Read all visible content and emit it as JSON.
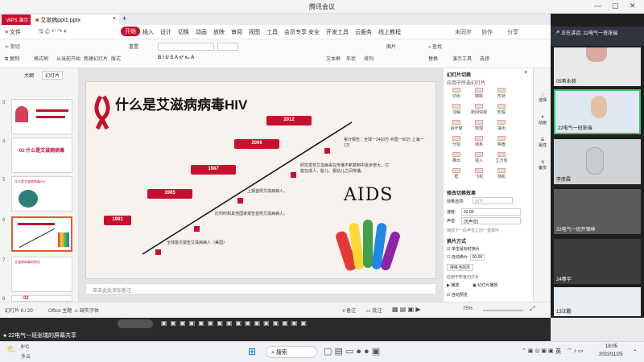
{
  "window_title": "腾讯会议",
  "app": {
    "tabs": [
      "WPS 演示",
      "艾滋病ppt1.pptx"
    ],
    "menu": [
      "≡ 文件",
      "开始",
      "插入",
      "设计",
      "切换",
      "动画",
      "放映",
      "审阅",
      "视图",
      "工具",
      "会员专享",
      "安全",
      "开发工具",
      "云服务",
      "线上教程"
    ],
    "menu_right": [
      "未同步",
      "协作",
      "分享"
    ],
    "ribbon_labels": [
      "剪切",
      "复制",
      "格式刷",
      "从当前开始",
      "新建幻灯片",
      "版式",
      "重置",
      "文本框",
      "形状",
      "排列",
      "图片",
      "查找",
      "替换",
      "演示工具",
      "选择"
    ],
    "pane_tabs": [
      "大纲",
      "幻灯片"
    ],
    "slide_numbers": [
      "3",
      "4",
      "5",
      "6",
      "7",
      "8"
    ],
    "thumb_titles": [
      "01 什么是艾滋病病毒",
      "什么是艾滋病病毒HIV",
      "艾滋病病毒的特点",
      "02"
    ],
    "notes_placeholder": "单击此处添加备注",
    "status": {
      "slide_count": "幻灯片 6 / 20",
      "theme": "Office 主题",
      "font_missing": "缺失字体",
      "notes_btn": "备注",
      "comments_btn": "批注",
      "zoom": "75%"
    }
  },
  "slide": {
    "title": "什么是艾滋病病毒HIV",
    "years": [
      "1981",
      "1985",
      "1987",
      "2006",
      "2012"
    ],
    "events": [
      "全球首次报告艾滋病病人（美国）",
      "比利时和其他国家报告首例艾滋病病人。",
      "上报首例艾滋病病人。",
      "研究发现艾滋病毒在传播不断复制中逐步增大，它能在成人、胎儿、婴幼儿之间传播。",
      "累计报告：全球一2400万 中国一50万 上海一1万"
    ],
    "aids_logo": "AIDS"
  },
  "transition_pane": {
    "header": "幻灯片切换",
    "apply_label": "应用于所选幻灯片",
    "effects": [
      "切出",
      "擦除",
      "形状",
      "溶解",
      "新闻快报",
      "轮辐",
      "百叶窗",
      "梳理",
      "抽出",
      "分割",
      "线条",
      "棋盘",
      "推出",
      "插入",
      "立方体",
      "框",
      "飞机",
      "随机"
    ],
    "modify_header": "修改切换效果",
    "effect_label": "效果选项:",
    "effect_value": "向下",
    "speed_label": "速度:",
    "speed_value": "02.00",
    "sound_label": "声音:",
    "sound_value": "[无声音]",
    "sound_loop": "播放下一段声音之前一直循环",
    "advance_header": "换片方式",
    "click_advance": "单击鼠标时换片",
    "auto_advance": "自动换片:",
    "auto_value": "00:00",
    "rehearse": "排练当前页",
    "apply_all": "应用于所有幻灯片",
    "play_btn": "播放",
    "show_btn": "幻灯片播放",
    "autopreview": "自动预览"
  },
  "right_tools": [
    "选择",
    "动画",
    "属性",
    "备份"
  ],
  "meeting": {
    "speaking": "正在讲话: 22电气一班张瑞",
    "share_notice": "22电气一班张瑞的屏幕共享",
    "participants": [
      "05蒋永赫",
      "22电气一班张瑞",
      "李彦霖",
      "22电气一班开钢林",
      "24蔡宇",
      "13汪鹏"
    ]
  },
  "taskbar": {
    "weather_temp": "9°C",
    "weather_desc": "多云",
    "search": "搜索",
    "lang": "英",
    "time": "18:05",
    "date": "2022/11/25"
  }
}
